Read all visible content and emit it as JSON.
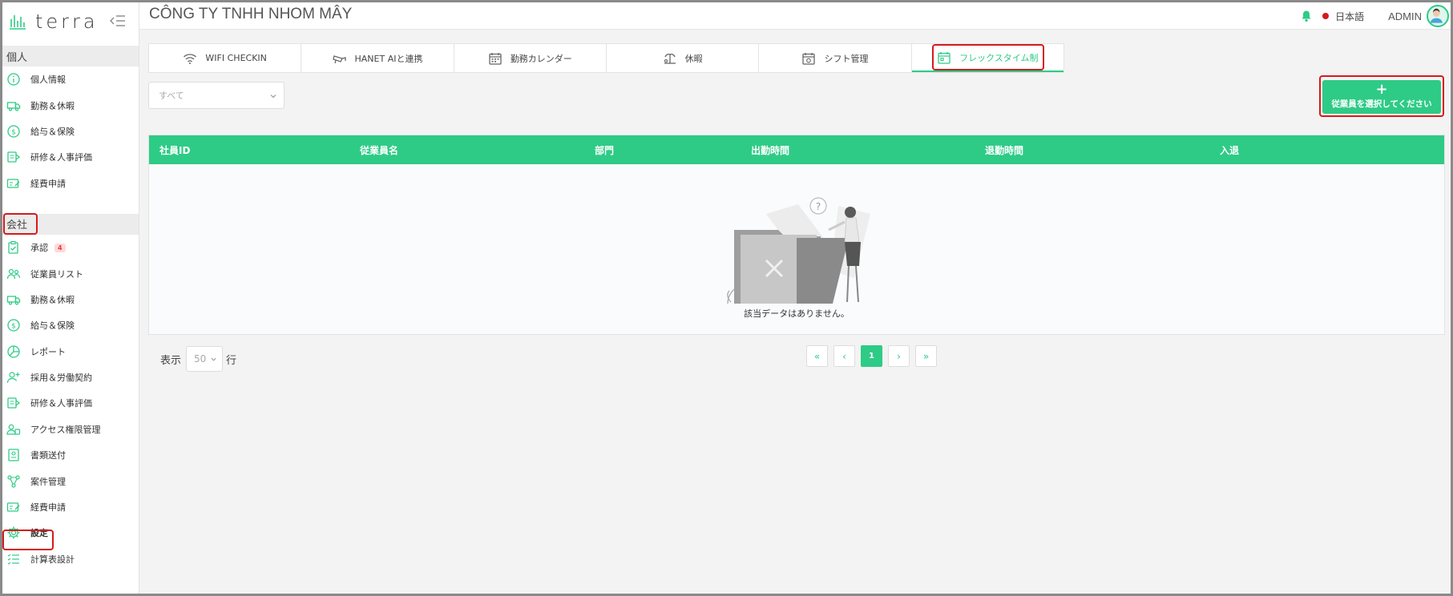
{
  "app": {
    "logo_text": "terra"
  },
  "header": {
    "company": "CÔNG TY TNHH NHOM MÂY",
    "language": "日本語",
    "user": "ADMIN"
  },
  "sidebar": {
    "personal_title": "個人",
    "personal_items": [
      {
        "label": "個人情報",
        "icon": "info-circle-icon"
      },
      {
        "label": "勤務＆休暇",
        "icon": "truck-icon"
      },
      {
        "label": "給与＆保険",
        "icon": "dollar-circle-icon"
      },
      {
        "label": "研修＆人事評価",
        "icon": "training-icon"
      },
      {
        "label": "経費申請",
        "icon": "expense-icon"
      }
    ],
    "company_title": "会社",
    "company_items": [
      {
        "label": "承認",
        "icon": "approval-icon",
        "badge": "4"
      },
      {
        "label": "従業員リスト",
        "icon": "users-icon"
      },
      {
        "label": "勤務＆休暇",
        "icon": "truck-icon"
      },
      {
        "label": "給与＆保険",
        "icon": "dollar-circle-icon"
      },
      {
        "label": "レポート",
        "icon": "pie-chart-icon"
      },
      {
        "label": "採用＆労働契約",
        "icon": "user-add-icon"
      },
      {
        "label": "研修＆人事評価",
        "icon": "training-icon"
      },
      {
        "label": "アクセス権限管理",
        "icon": "access-icon"
      },
      {
        "label": "書類送付",
        "icon": "document-icon"
      },
      {
        "label": "案件管理",
        "icon": "network-icon"
      },
      {
        "label": "経費申請",
        "icon": "expense-icon"
      },
      {
        "label": "設定",
        "icon": "gear-icon"
      },
      {
        "label": "計算表設計",
        "icon": "list-icon"
      }
    ]
  },
  "tabs": [
    {
      "label": "WIFI CHECKIN",
      "icon": "wifi-icon"
    },
    {
      "label": "HANET AIと連携",
      "icon": "camera-icon"
    },
    {
      "label": "勤務カレンダー",
      "icon": "calendar-icon"
    },
    {
      "label": "休暇",
      "icon": "vacation-icon"
    },
    {
      "label": "シフト管理",
      "icon": "shift-icon"
    },
    {
      "label": "フレックスタイム制",
      "icon": "flex-calendar-icon"
    }
  ],
  "filter": {
    "value": "すべて"
  },
  "add_button": {
    "plus": "+",
    "label": "従業員を選択してください"
  },
  "table": {
    "columns": [
      "社員ID",
      "従業員名",
      "部門",
      "出勤時間",
      "退勤時間",
      "入退"
    ],
    "empty_text": "該当データはありません。"
  },
  "pagination": {
    "show_label": "表示",
    "rows_value": "50",
    "rows_suffix": "行",
    "first": "«",
    "prev": "‹",
    "current": "1",
    "next": "›",
    "last": "»"
  },
  "colors": {
    "accent": "#2ecb86",
    "highlight": "#d61a1a"
  }
}
